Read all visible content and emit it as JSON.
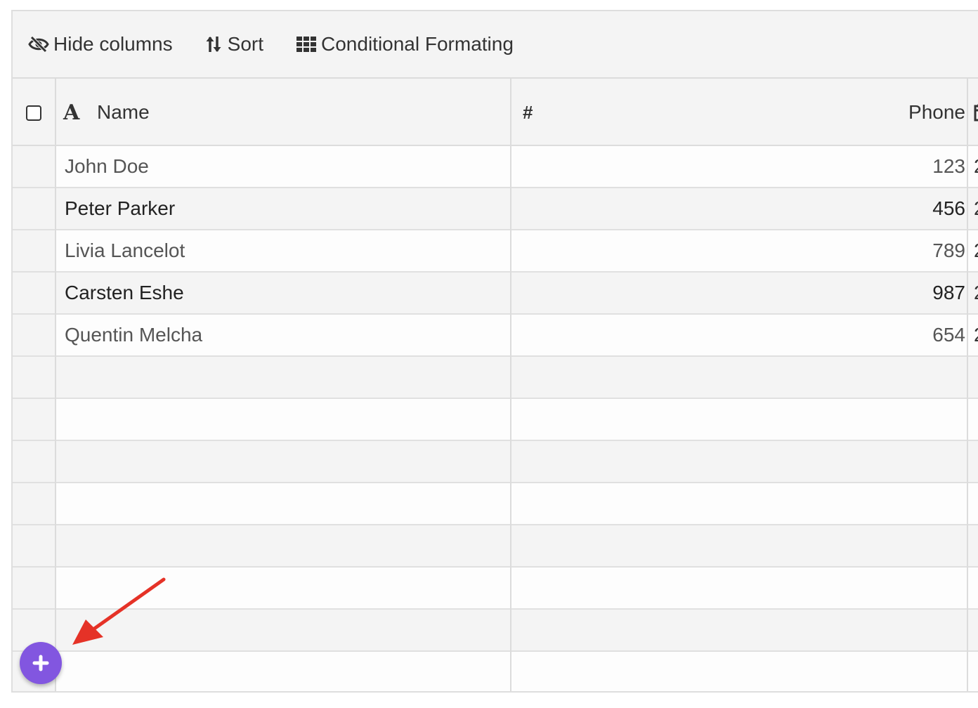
{
  "toolbar": {
    "hide_columns_label": "Hide columns",
    "sort_label": "Sort",
    "conditional_formatting_label": "Conditional Formating"
  },
  "columns": {
    "name_label": "Name",
    "number_label": "#",
    "phone_label": "Phone"
  },
  "rows": [
    {
      "name": "John Doe",
      "phone": "123",
      "next": "2"
    },
    {
      "name": "Peter Parker",
      "phone": "456",
      "next": "2"
    },
    {
      "name": "Livia Lancelot",
      "phone": "789",
      "next": "2"
    },
    {
      "name": "Carsten Eshe",
      "phone": "987",
      "next": "2"
    },
    {
      "name": "Quentin Melcha",
      "phone": "654",
      "next": "2"
    },
    {
      "name": "",
      "phone": "",
      "next": ""
    },
    {
      "name": "",
      "phone": "",
      "next": ""
    },
    {
      "name": "",
      "phone": "",
      "next": ""
    },
    {
      "name": "",
      "phone": "",
      "next": ""
    },
    {
      "name": "",
      "phone": "",
      "next": ""
    },
    {
      "name": "",
      "phone": "",
      "next": ""
    },
    {
      "name": "",
      "phone": "",
      "next": ""
    },
    {
      "name": "",
      "phone": "",
      "next": ""
    }
  ],
  "colors": {
    "fab": "#8256e0",
    "annotation_arrow": "#e53227"
  },
  "icons": {
    "hide": "eye-slash-icon",
    "sort": "sort-arrows-icon",
    "conditional": "grid-icon",
    "text_column": "text-a-icon",
    "date_column": "calendar-icon",
    "add": "plus-icon"
  }
}
